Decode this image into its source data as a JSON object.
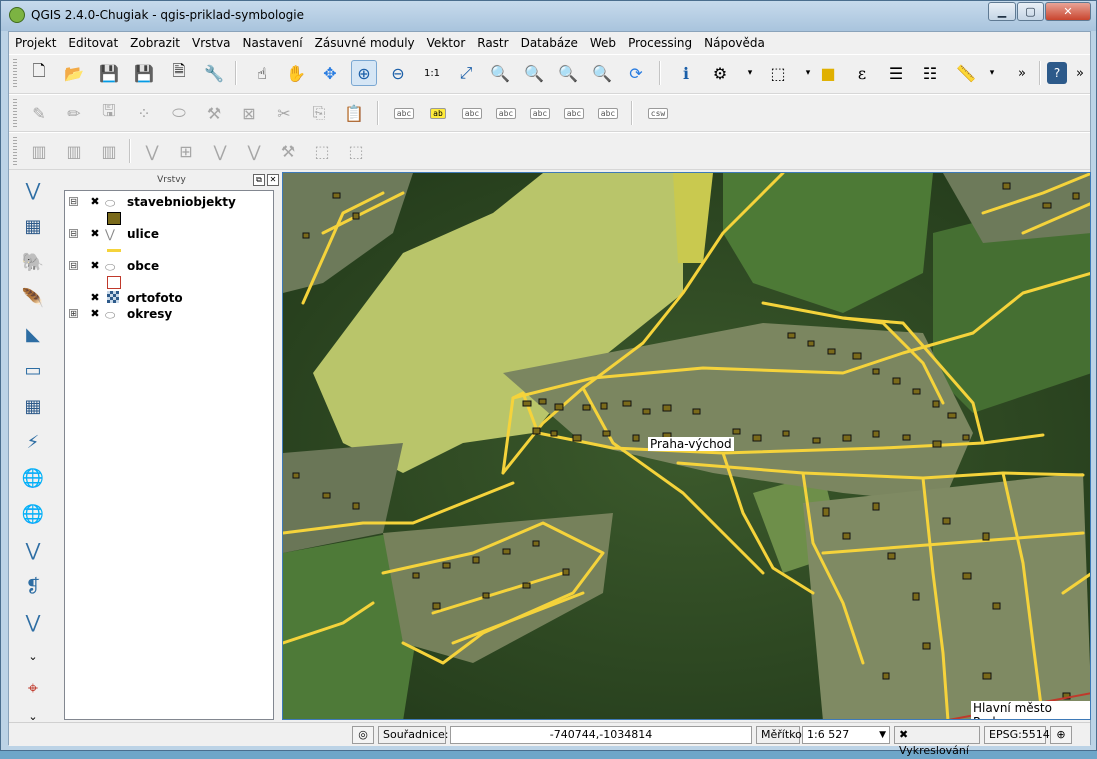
{
  "window": {
    "title": "QGIS 2.4.0-Chugiak - qgis-priklad-symbologie",
    "minimize": "▁",
    "maximize": "▢",
    "close": "✕"
  },
  "menu": [
    "Projekt",
    "Editovat",
    "Zobrazit",
    "Vrstva",
    "Nastavení",
    "Zásuvné moduly",
    "Vektor",
    "Rastr",
    "Databáze",
    "Web",
    "Processing",
    "Nápověda"
  ],
  "toolbar_overflow": "»",
  "labeling_icons": [
    "abc",
    "ab",
    "abc",
    "abc",
    "abc",
    "abc",
    "abc",
    "abc",
    "csw"
  ],
  "layers_panel": {
    "title": "Vrstvy",
    "float": "⧉",
    "close": "✕",
    "layers": [
      {
        "name": "stavebniobjekty",
        "checked": "✖",
        "expanded": "⊟",
        "symbol_color": "#7a6a1a"
      },
      {
        "name": "ulice",
        "checked": "✖",
        "expanded": "⊟",
        "symbol_color": "#f5d33b"
      },
      {
        "name": "obce",
        "checked": "✖",
        "expanded": "⊟",
        "symbol_color": "#c0392b"
      },
      {
        "name": "ortofoto",
        "checked": "✖",
        "expanded": "",
        "symbol_color": ""
      },
      {
        "name": "okresy",
        "checked": "✖",
        "expanded": "⊞",
        "symbol_color": ""
      }
    ]
  },
  "map": {
    "labels": {
      "praha_vychod": "Praha-východ",
      "hlavni_mesto": "Hlavní město Praha"
    }
  },
  "status": {
    "coords_label": "Souřadnice:",
    "coords_value": "-740744,-1034814",
    "scale_label": "Měřítko",
    "scale_value": "1:6 527",
    "render_check": "✖",
    "render_label": "Vykreslování",
    "crs": "EPSG:5514"
  },
  "colors": {
    "accent": "#3e7ab8",
    "roads": "#f5d33b",
    "buildings": "#7a6a1a",
    "boundary": "#c0392b"
  }
}
